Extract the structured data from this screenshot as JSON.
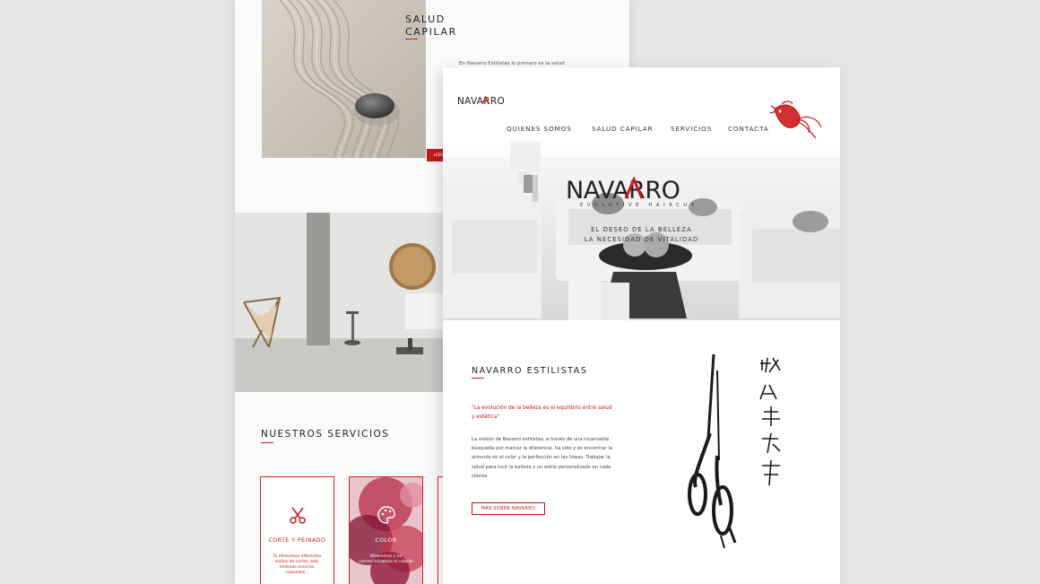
{
  "back_page": {
    "salud_title_line1": "SALUD",
    "salud_title_line2": "CAPILAR",
    "salud_text": "En Navarro Estilistas lo primero es la salud",
    "leer_label": "LEER",
    "servicios_title": "NUESTROS SERVICIOS",
    "services": [
      {
        "name": "CORTE Y PEINADO",
        "desc": "Te ofrecemos diferentes estilos de cortes, bob, melenas enceras, capeadas...",
        "icon": "scissors-icon"
      },
      {
        "name": "COLOR",
        "desc": "Ofrecemos y no comercializamos el cabello",
        "icon": "palette-icon"
      },
      {
        "name": "",
        "desc": "",
        "icon": ""
      }
    ]
  },
  "front_page": {
    "logo_text": "NAVARRO",
    "nav": [
      "QUIENES SOMOS",
      "SALUD CAPILAR",
      "SERVICIOS",
      "CONTACTA"
    ],
    "hero": {
      "brand": "NAVARRO",
      "subtitle": "EVOLUTIVE HAIRCUT",
      "tagline1": "EL DESEO DE LA BELLEZA",
      "tagline2": "LA NECESIDAD DE VITALIDAD"
    },
    "about": {
      "title": "NAVARRO ESTILISTAS",
      "quote": "\"La evolución de la belleza es el equilibrio entre salud y estética\"",
      "body": "La misión de Navarro estilistas, a través de una incansable búsqueda por marcar la diferencia, ha sido y es encontrar la armonía en el color y la perfección en las líneas. Trabajar la salud para lucir la belleza y un estilo personalizado en cada cliente.",
      "button": "MÁS SOBRE NAVARRO"
    }
  },
  "colors": {
    "accent": "#d51f1f",
    "background": "#e6e6e6",
    "page": "#ffffff"
  }
}
